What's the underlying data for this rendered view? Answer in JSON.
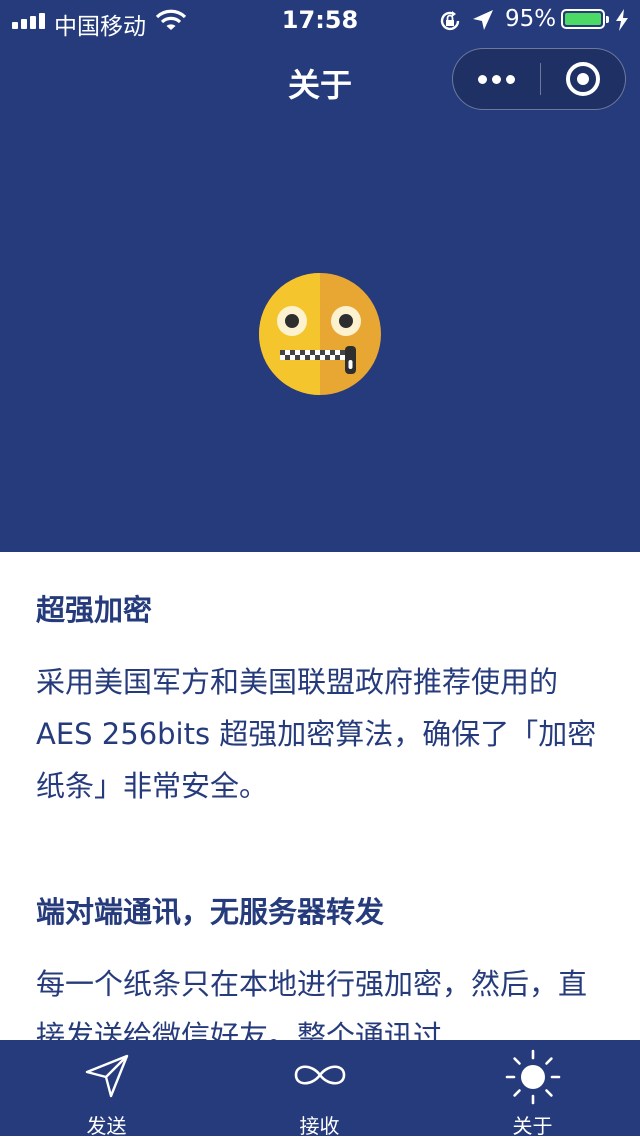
{
  "status": {
    "carrier": "中国移动",
    "time": "17:58",
    "battery_percent": "95%",
    "battery_level": 0.95
  },
  "nav": {
    "title": "关于"
  },
  "sections": [
    {
      "heading": "超强加密",
      "body": "采用美国军方和美国联盟政府推荐使用的 AES 256bits 超强加密算法，确保了「加密纸条」非常安全。"
    },
    {
      "heading": "端对端通讯，无服务器转发",
      "body": "每一个纸条只在本地进行强加密，然后，直接发送给微信好友。整个通讯过"
    }
  ],
  "tabs": [
    {
      "label": "发送",
      "icon": "send-icon"
    },
    {
      "label": "接收",
      "icon": "infinity-icon"
    },
    {
      "label": "关于",
      "icon": "sun-icon"
    }
  ],
  "colors": {
    "brand": "#263b7c",
    "emoji_left": "#f5c52d",
    "emoji_right": "#e8a633",
    "battery": "#4cd964"
  }
}
